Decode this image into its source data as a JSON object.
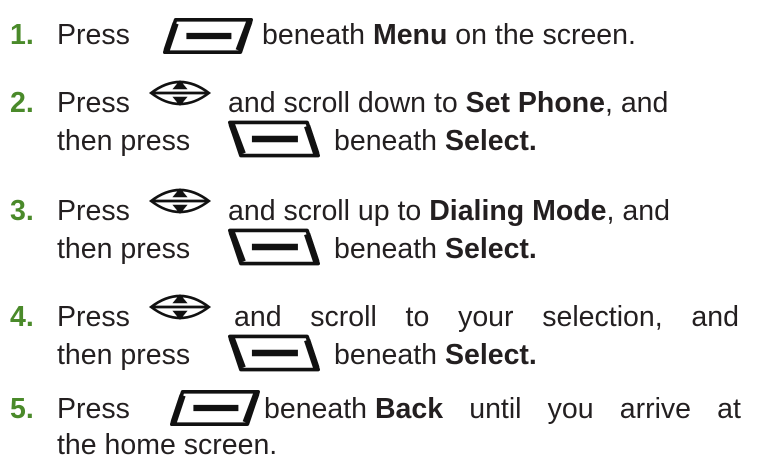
{
  "colors": {
    "number": "#4a8a2a",
    "text": "#231f20"
  },
  "steps": [
    {
      "number": "1.",
      "press": "Press",
      "icon": "left-soft-key-icon",
      "after": "beneath",
      "bold": "Menu",
      "rest": "on the screen."
    },
    {
      "number": "2.",
      "press": "Press",
      "icon": "navigation-key-icon",
      "after": "and scroll down to",
      "bold": "Set Phone",
      "tail": ", and",
      "line2_pre": "then press",
      "icon2": "right-soft-key-icon",
      "line2_after": "beneath",
      "line2_bold": "Select."
    },
    {
      "number": "3.",
      "press": "Press",
      "icon": "navigation-key-icon",
      "after": "and scroll up to",
      "bold": "Dialing Mode",
      "tail": ", and",
      "line2_pre": "then press",
      "icon2": "right-soft-key-icon",
      "line2_after": "beneath",
      "line2_bold": "Select."
    },
    {
      "number": "4.",
      "press": "Press",
      "icon": "navigation-key-icon",
      "w1": "and",
      "w2": "scroll",
      "w3": "to",
      "w4": "your",
      "w5": "selection,",
      "w6": "and",
      "line2_pre": "then press",
      "icon2": "right-soft-key-icon",
      "line2_after": "beneath",
      "line2_bold": "Select."
    },
    {
      "number": "5.",
      "press": "Press",
      "icon": "left-soft-key-icon",
      "after": "beneath",
      "bold": "Back",
      "w1": "until",
      "w2": "you",
      "w3": "arrive",
      "w4": "at",
      "line2": "the home screen."
    }
  ]
}
